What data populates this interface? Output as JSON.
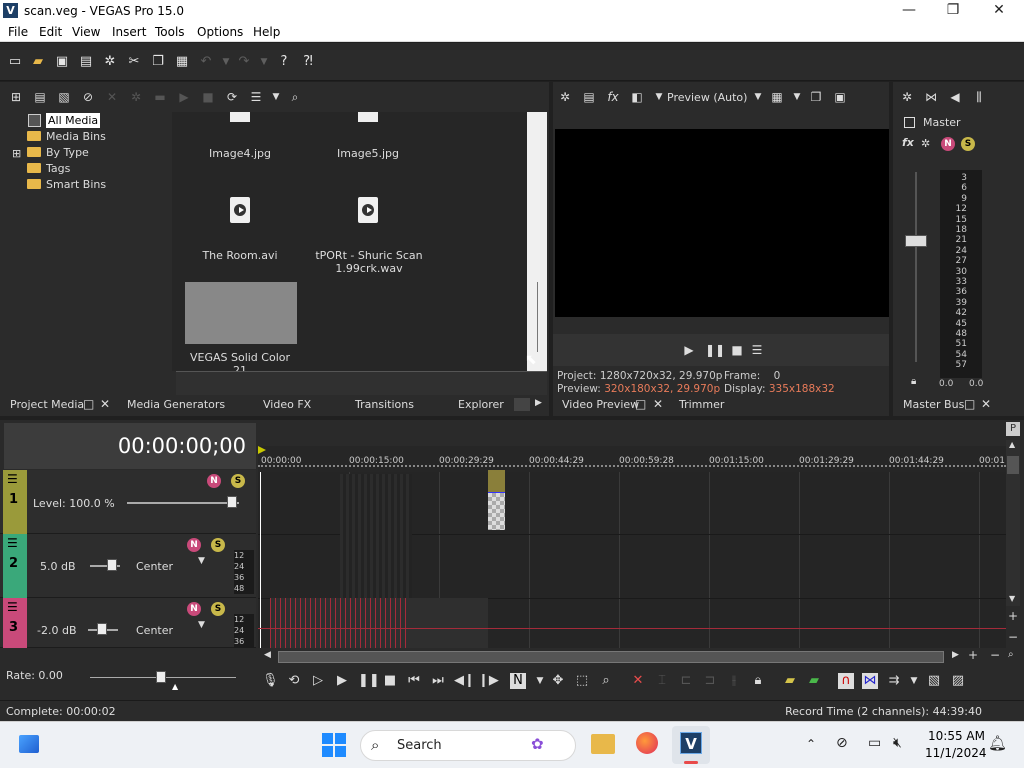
{
  "window": {
    "title": "scan.veg - VEGAS Pro 15.0",
    "logo": "V",
    "minimize": "—",
    "maximize": "❐",
    "close": "✕"
  },
  "menu": [
    "File",
    "Edit",
    "View",
    "Insert",
    "Tools",
    "Options",
    "Help"
  ],
  "toolbar_icons": [
    "new-icon",
    "open-icon",
    "save-icon",
    "save-as-icon",
    "properties-icon",
    "cut-icon",
    "copy-icon",
    "paste-icon",
    "undo-icon",
    "undo-dropdown-icon",
    "redo-icon",
    "redo-dropdown-icon",
    "help-icon",
    "whats-this-icon"
  ],
  "project_media": {
    "tree": [
      "All Media",
      "Media Bins",
      "By Type",
      "Tags",
      "Smart Bins"
    ],
    "expand": "⊞",
    "items": [
      {
        "label": "Image4.jpg"
      },
      {
        "label": "Image5.jpg"
      },
      {
        "label": "The Room.avi"
      },
      {
        "label": "tPORt - Shuric Scan 1.99crk.wav"
      },
      {
        "label": "VEGAS Solid Color 21"
      }
    ]
  },
  "left_tabs": [
    "Project Media",
    "Media Generators",
    "Video FX",
    "Transitions",
    "Explorer"
  ],
  "video_preview": {
    "preview_mode": "Preview (Auto)",
    "project_label": "Project:",
    "project_value": "1280x720x32, 29.970p",
    "preview_label": "Preview:",
    "preview_value": "320x180x32, 29.970p",
    "frame_label": "Frame:",
    "frame_value": "0",
    "display_label": "Display:",
    "display_value": "335x188x32",
    "accent_color": "#e87b5a"
  },
  "preview_tabs": [
    "Video Preview",
    "Trimmer"
  ],
  "master_bus": {
    "label": "Master",
    "fx": "fx",
    "scale": [
      "3",
      "6",
      "9",
      "12",
      "15",
      "18",
      "21",
      "24",
      "27",
      "30",
      "33",
      "36",
      "39",
      "42",
      "45",
      "48",
      "51",
      "54",
      "57"
    ],
    "left_value": "0.0",
    "right_value": "0.0",
    "tab": "Master Bus"
  },
  "timeline": {
    "timecode": "00:00:00;00",
    "ruler": [
      "00:00:00",
      "00:00:15:00",
      "00:00:29:29",
      "00:00:44:29",
      "00:00:59:28",
      "00:01:15:00",
      "00:01:29:29",
      "00:01:44:29",
      "00:01"
    ],
    "tracks": [
      {
        "number": "1",
        "type": "video",
        "level_label": "Level: 100.0 %"
      },
      {
        "number": "2",
        "type": "audio",
        "volume": "5.0 dB",
        "pan": "Center",
        "scale": [
          "12",
          "24",
          "36",
          "48"
        ]
      },
      {
        "number": "3",
        "type": "audio",
        "volume": "-2.0 dB",
        "pan": "Center",
        "scale": [
          "12",
          "24",
          "36"
        ]
      }
    ],
    "rate": "Rate: 0.00"
  },
  "status": {
    "left": "Complete: 00:00:02",
    "right": "Record Time (2 channels): 44:39:40"
  },
  "taskbar": {
    "search": "Search",
    "time": "10:55 AM",
    "date": "11/1/2024"
  }
}
